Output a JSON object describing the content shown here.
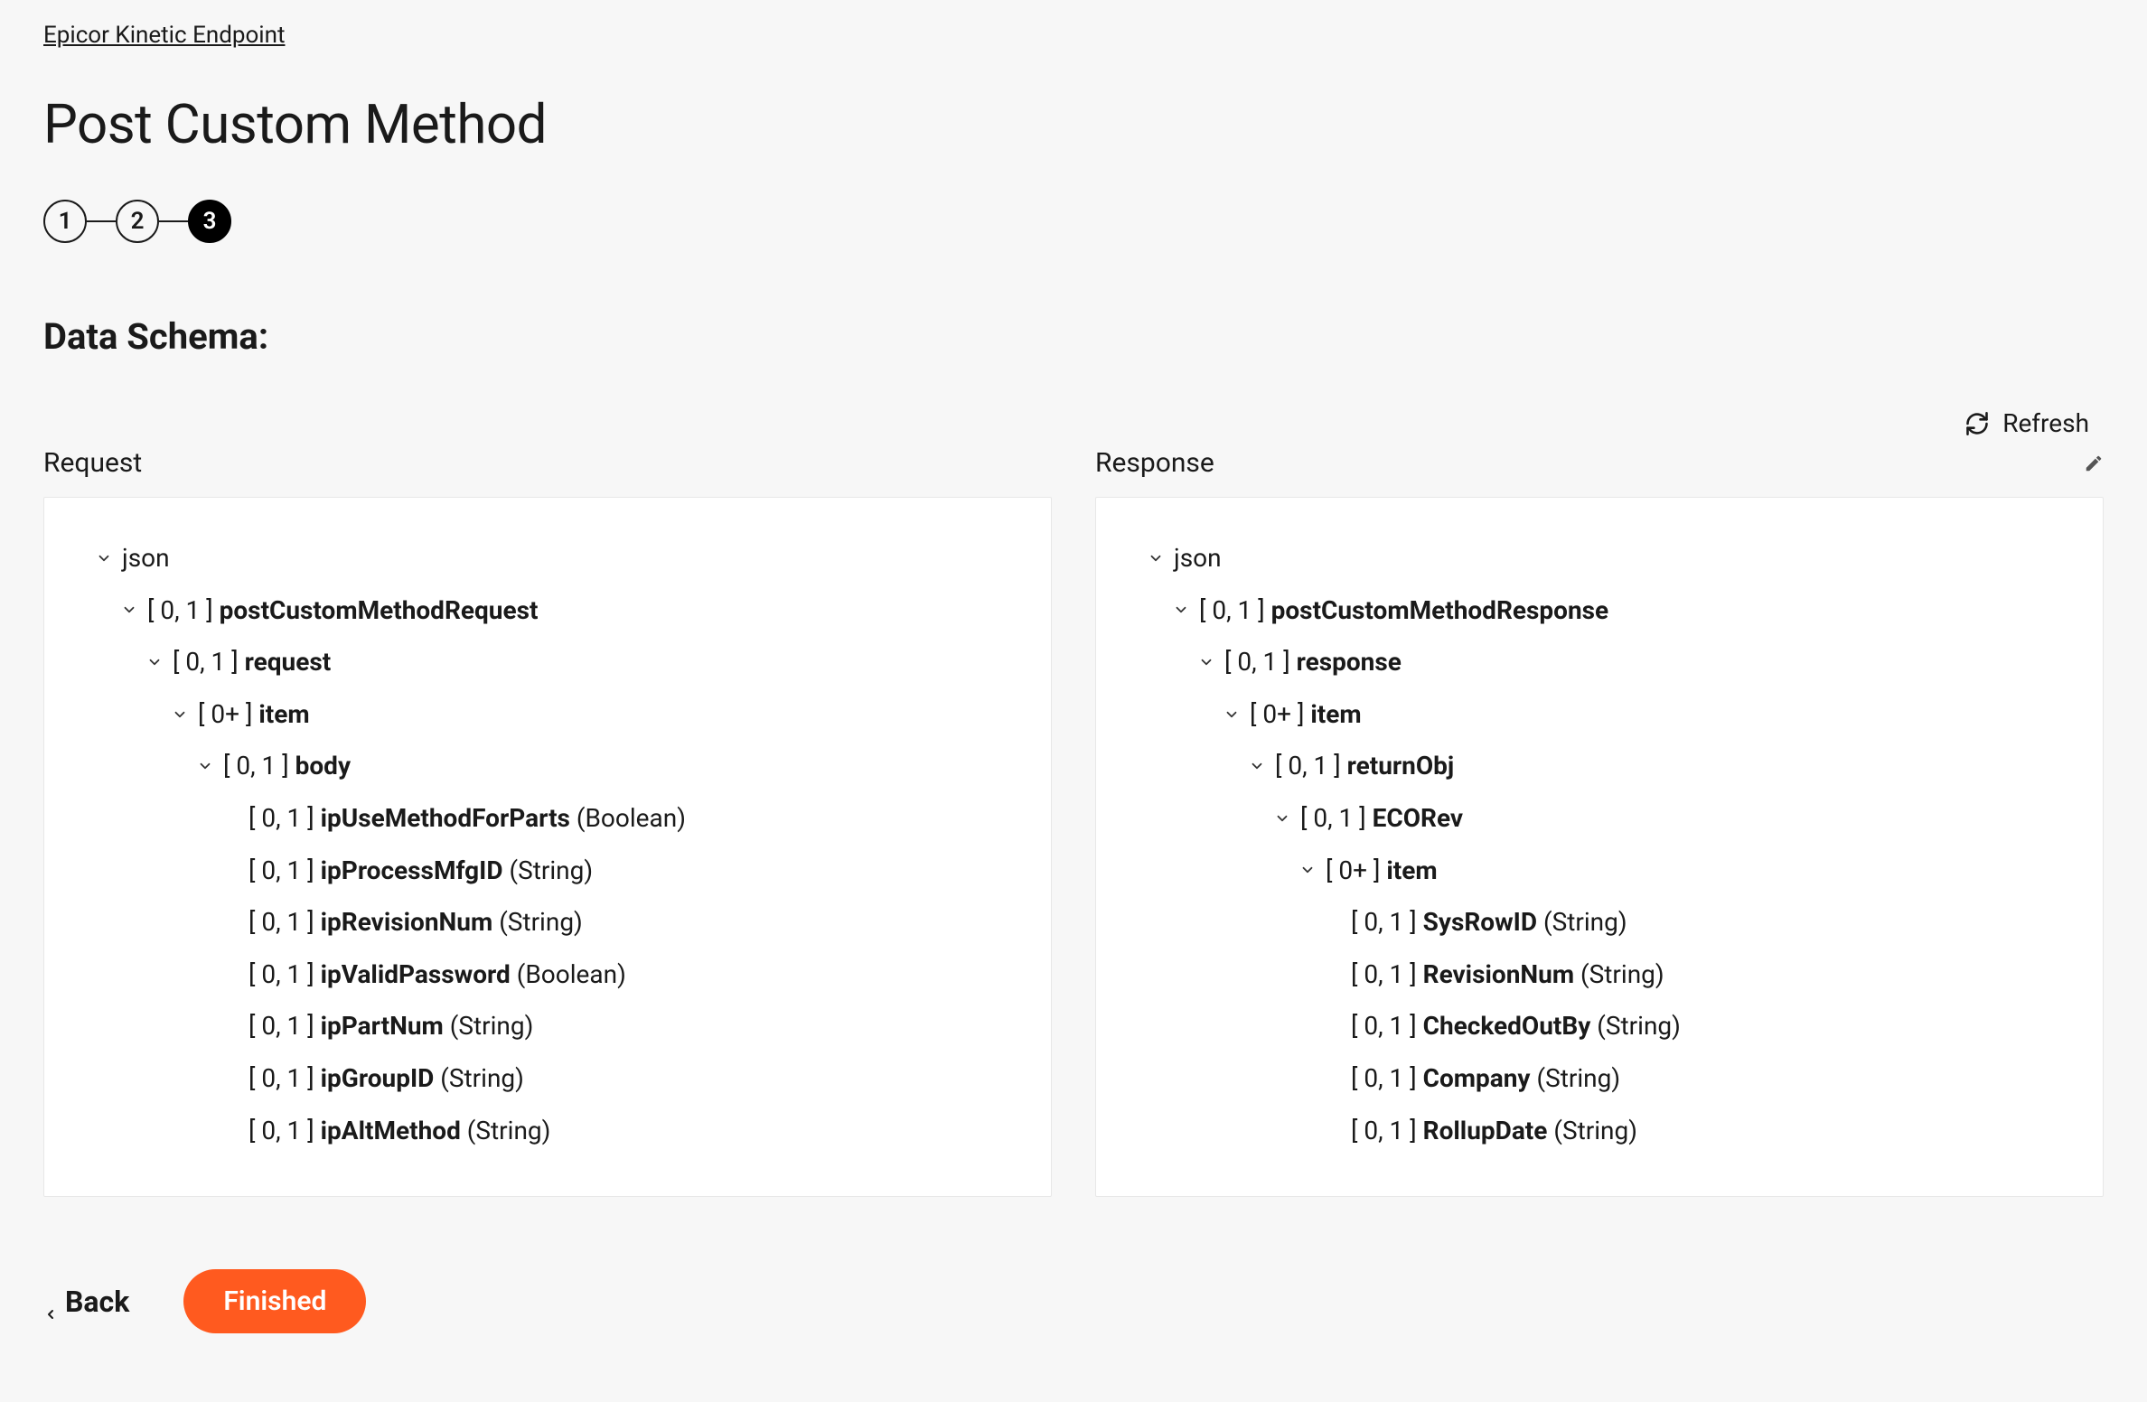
{
  "breadcrumb": "Epicor Kinetic Endpoint",
  "page_title": "Post Custom Method",
  "stepper": {
    "steps": [
      "1",
      "2",
      "3"
    ],
    "active_index": 2
  },
  "section_heading": "Data Schema:",
  "toolbar": {
    "refresh_label": "Refresh"
  },
  "columns": {
    "request": {
      "header": "Request",
      "tree": [
        {
          "indent": 0,
          "chevron": true,
          "card": "",
          "name": "json",
          "type": ""
        },
        {
          "indent": 1,
          "chevron": true,
          "card": "[ 0, 1 ]",
          "name": "postCustomMethodRequest",
          "type": ""
        },
        {
          "indent": 2,
          "chevron": true,
          "card": "[ 0, 1 ]",
          "name": "request",
          "type": ""
        },
        {
          "indent": 3,
          "chevron": true,
          "card": "[ 0+ ]",
          "name": "item",
          "type": ""
        },
        {
          "indent": 4,
          "chevron": true,
          "card": "[ 0, 1 ]",
          "name": "body",
          "type": ""
        },
        {
          "indent": 5,
          "chevron": false,
          "card": "[ 0, 1 ]",
          "name": "ipUseMethodForParts",
          "type": "(Boolean)"
        },
        {
          "indent": 5,
          "chevron": false,
          "card": "[ 0, 1 ]",
          "name": "ipProcessMfgID",
          "type": "(String)"
        },
        {
          "indent": 5,
          "chevron": false,
          "card": "[ 0, 1 ]",
          "name": "ipRevisionNum",
          "type": "(String)"
        },
        {
          "indent": 5,
          "chevron": false,
          "card": "[ 0, 1 ]",
          "name": "ipValidPassword",
          "type": "(Boolean)"
        },
        {
          "indent": 5,
          "chevron": false,
          "card": "[ 0, 1 ]",
          "name": "ipPartNum",
          "type": "(String)"
        },
        {
          "indent": 5,
          "chevron": false,
          "card": "[ 0, 1 ]",
          "name": "ipGroupID",
          "type": "(String)"
        },
        {
          "indent": 5,
          "chevron": false,
          "card": "[ 0, 1 ]",
          "name": "ipAltMethod",
          "type": "(String)"
        }
      ]
    },
    "response": {
      "header": "Response",
      "tree": [
        {
          "indent": 0,
          "chevron": true,
          "card": "",
          "name": "json",
          "type": ""
        },
        {
          "indent": 1,
          "chevron": true,
          "card": "[ 0, 1 ]",
          "name": "postCustomMethodResponse",
          "type": ""
        },
        {
          "indent": 2,
          "chevron": true,
          "card": "[ 0, 1 ]",
          "name": "response",
          "type": ""
        },
        {
          "indent": 3,
          "chevron": true,
          "card": "[ 0+ ]",
          "name": "item",
          "type": ""
        },
        {
          "indent": 4,
          "chevron": true,
          "card": "[ 0, 1 ]",
          "name": "returnObj",
          "type": ""
        },
        {
          "indent": 5,
          "chevron": true,
          "card": "[ 0, 1 ]",
          "name": "ECORev",
          "type": ""
        },
        {
          "indent": 6,
          "chevron": true,
          "card": "[ 0+ ]",
          "name": "item",
          "type": ""
        },
        {
          "indent": 7,
          "chevron": false,
          "card": "[ 0, 1 ]",
          "name": "SysRowID",
          "type": "(String)"
        },
        {
          "indent": 7,
          "chevron": false,
          "card": "[ 0, 1 ]",
          "name": "RevisionNum",
          "type": "(String)"
        },
        {
          "indent": 7,
          "chevron": false,
          "card": "[ 0, 1 ]",
          "name": "CheckedOutBy",
          "type": "(String)"
        },
        {
          "indent": 7,
          "chevron": false,
          "card": "[ 0, 1 ]",
          "name": "Company",
          "type": "(String)"
        },
        {
          "indent": 7,
          "chevron": false,
          "card": "[ 0, 1 ]",
          "name": "RollupDate",
          "type": "(String)"
        }
      ]
    }
  },
  "footer": {
    "back_label": "Back",
    "finished_label": "Finished"
  }
}
